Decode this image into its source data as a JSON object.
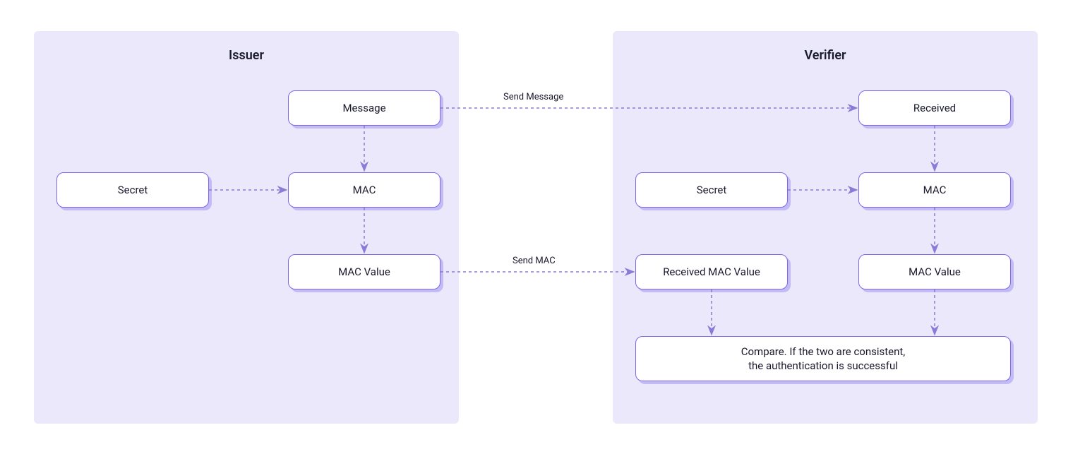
{
  "issuer": {
    "title": "Issuer",
    "nodes": {
      "message": "Message",
      "secret": "Secret",
      "mac": "MAC",
      "mac_value": "MAC Value"
    }
  },
  "verifier": {
    "title": "Verifier",
    "nodes": {
      "received": "Received",
      "secret": "Secret",
      "mac": "MAC",
      "received_mac_value": "Received MAC Value",
      "mac_value": "MAC Value",
      "compare": "Compare. If the two are consistent,\nthe authentication is successful"
    }
  },
  "edges": {
    "send_message": "Send Message",
    "send_mac": "Send MAC"
  },
  "colors": {
    "panel_bg": "#eae8fa",
    "node_border": "#7b68ee",
    "arrow": "#8b7ad6"
  }
}
